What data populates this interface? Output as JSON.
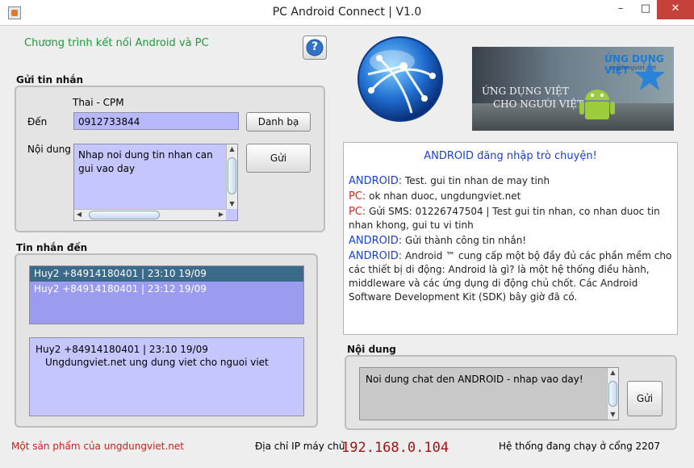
{
  "window": {
    "title": "PC Android Connect | V1.0",
    "minimize": "–",
    "maximize": "□",
    "close": "✕"
  },
  "header": {
    "subtitle": "Chương trình kết nối Android và PC",
    "help_icon": "?"
  },
  "banner": {
    "brand": "ỨNG DỤNG VIỆT",
    "site": "ungdungviet.net",
    "tagline_1": "ỨNG DỤNG VIỆT",
    "tagline_2": "CHO NGƯỜI VIỆT"
  },
  "send": {
    "section": "Gửi tin nhắn",
    "contact_name": "Thai - CPM",
    "to_label": "Đến",
    "to_value": "0912733844",
    "contacts_button": "Danh bạ",
    "content_label": "Nội dung",
    "content_placeholder": "Nhap noi dung tin nhan can gui vao day",
    "send_button": "Gửi"
  },
  "inbox": {
    "section": "Tin nhắn đến",
    "items": [
      "Huy2 +84914180401 | 23:10 19/09",
      "Huy2 +84914180401 | 23:12 19/09"
    ],
    "selected_index": 0,
    "detail_header": "Huy2 +84914180401 | 23:10 19/09",
    "detail_body": "Ungdungviet.net ung dung viet cho nguoi viet"
  },
  "chat": {
    "header": "ANDROID đăng nhập trò chuyện!",
    "messages": [
      {
        "who": "ANDROID:",
        "text": "Test. gui tin nhan de may tinh"
      },
      {
        "who": "PC:",
        "text": "ok nhan duoc, ungdungviet.net"
      },
      {
        "who": "PC:",
        "text": "Gửi SMS: 01226747504 | Test gui tin nhan, co nhan duoc tin nhan khong, gui tu vi tinh"
      },
      {
        "who": "ANDROID:",
        "text": "Gửi thành công tin nhắn!"
      },
      {
        "who": "ANDROID:",
        "text": "Android ™ cung cấp một bộ đầy đủ các phần mềm cho các thiết bị di động: Android là gì? là một hệ thống điều hành, middleware và các ứng dụng di động chủ chốt. Các Android Software Development Kit (SDK) bây giờ đã có."
      }
    ]
  },
  "compose": {
    "section": "Nội dung",
    "placeholder": "Noi dung chat den ANDROID - nhap vao day!",
    "send_button": "Gửi"
  },
  "footer": {
    "product": "Một sản phẩm của ungdungviet.net",
    "ip_label": "Địa chỉ IP máy chủ",
    "ip_value": "192.168.0.104",
    "port_status": "Hệ thống đang chạy ở cổng 2207"
  },
  "icons": [
    "app-icon",
    "help-icon",
    "globe-icon",
    "android-icon"
  ]
}
